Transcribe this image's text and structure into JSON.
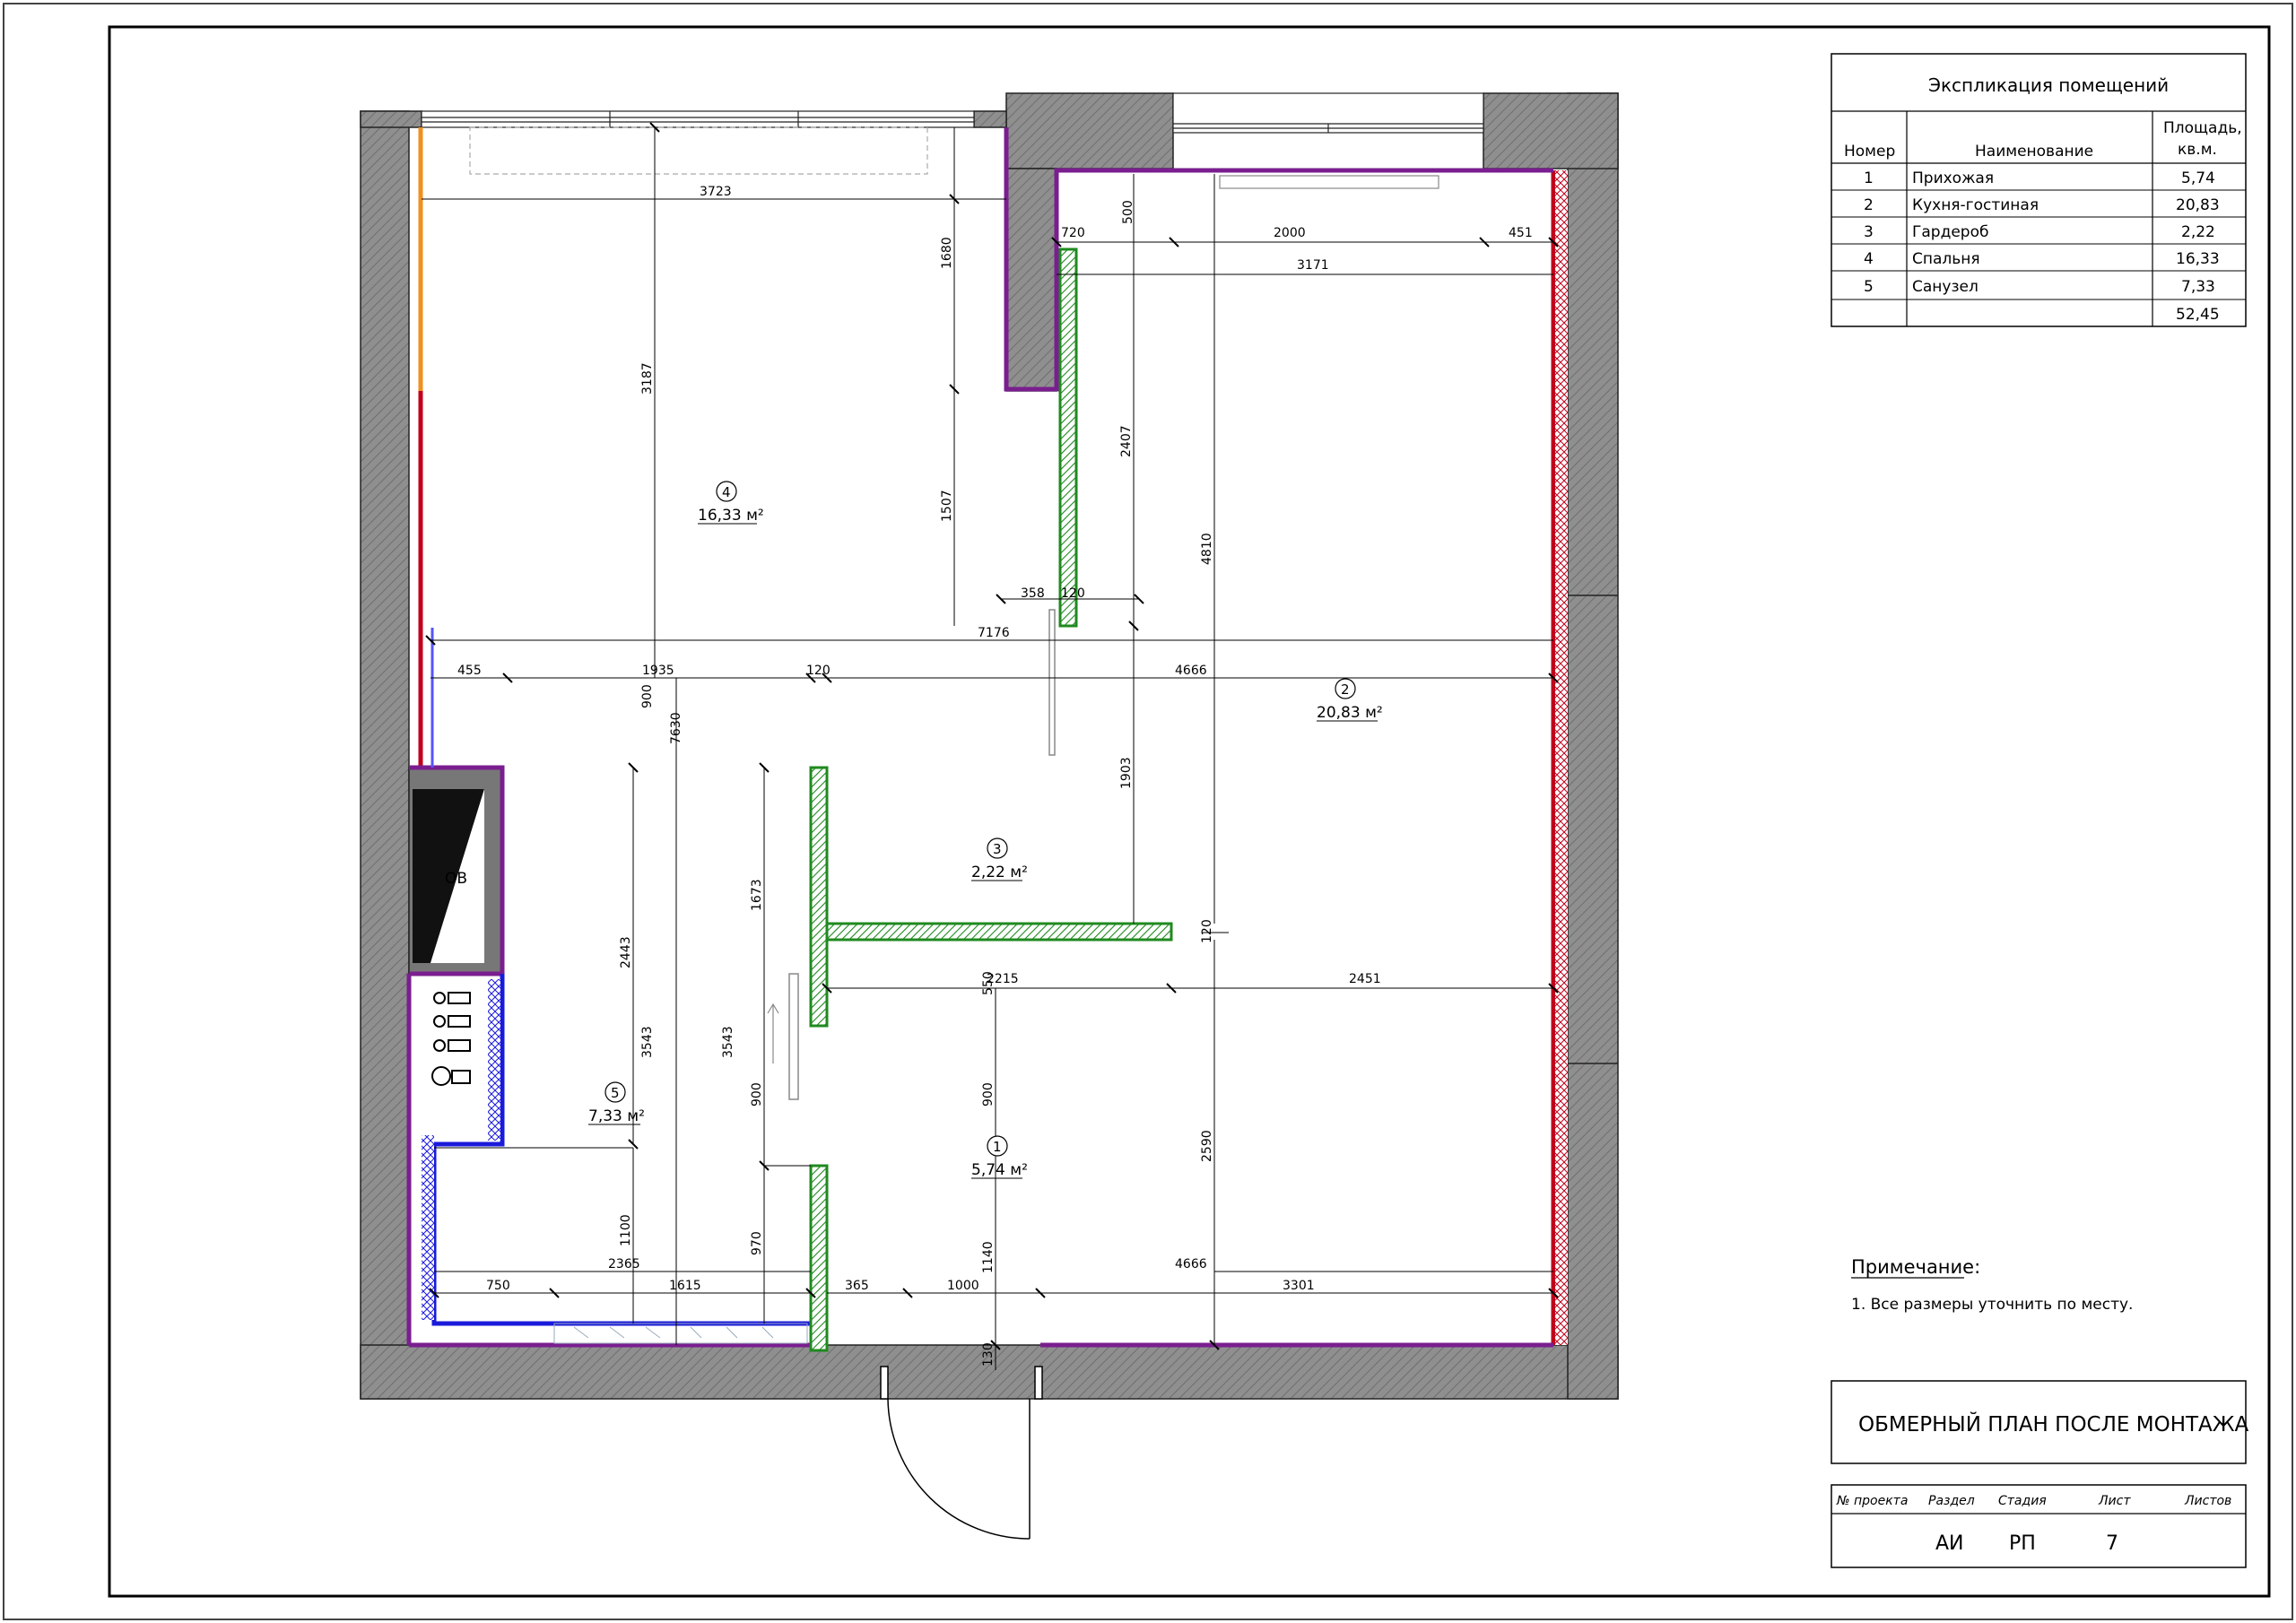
{
  "explication": {
    "title": "Экспликация помещений",
    "headers": {
      "number": "Номер",
      "name": "Наименование",
      "area_l1": "Площадь,",
      "area_l2": "кв.м."
    },
    "rows": [
      {
        "num": "1",
        "name": "Прихожая",
        "area": "5,74"
      },
      {
        "num": "2",
        "name": "Кухня-гостиная",
        "area": "20,83"
      },
      {
        "num": "3",
        "name": "Гардероб",
        "area": "2,22"
      },
      {
        "num": "4",
        "name": "Спальня",
        "area": "16,33"
      },
      {
        "num": "5",
        "name": "Санузел",
        "area": "7,33"
      }
    ],
    "total": "52,45"
  },
  "rooms": [
    {
      "num": "1",
      "area": "5,74 м²"
    },
    {
      "num": "2",
      "area": "20,83 м²"
    },
    {
      "num": "3",
      "area": "2,22 м²"
    },
    {
      "num": "4",
      "area": "16,33 м²"
    },
    {
      "num": "5",
      "area": "7,33 м²"
    }
  ],
  "equipment_label": "ОВ",
  "dimensions": {
    "d3723": "3723",
    "d500": "500",
    "d720": "720",
    "d2000": "2000",
    "d451": "451",
    "d3171": "3171",
    "d1680": "1680",
    "d3187": "3187",
    "d2407": "2407",
    "d1507": "1507",
    "d4810": "4810",
    "d358": "358",
    "d120a": "120",
    "d7176": "7176",
    "d455": "455",
    "d1935": "1935",
    "d120b": "120",
    "d4666a": "4666",
    "d900a": "900",
    "d7630": "7630",
    "d1903": "1903",
    "d2443": "2443",
    "d1673": "1673",
    "d120c": "120",
    "d550": "550",
    "d2215": "2215",
    "d2451": "2451",
    "d3543a": "3543",
    "d3543b": "3543",
    "d900b": "900",
    "d900c": "900",
    "d2590": "2590",
    "d1100": "1100",
    "d970": "970",
    "d1140": "1140",
    "d750": "750",
    "d2365": "2365",
    "d1615": "1615",
    "d365": "365",
    "d1000": "1000",
    "d4666b": "4666",
    "d3301": "3301",
    "d130": "130"
  },
  "note": {
    "title": "Примечание:",
    "text": "1. Все размеры уточнить по месту."
  },
  "stamp": {
    "title": "ОБМЕРНЫЙ ПЛАН ПОСЛЕ МОНТАЖА",
    "labels": {
      "project": "№ проекта",
      "section": "Раздел",
      "stage": "Стадия",
      "sheet": "Лист",
      "sheets": "Листов"
    },
    "values": {
      "section": "АИ",
      "stage": "РП",
      "sheet": "7"
    }
  },
  "colors": {
    "wall": "#8c8c8c",
    "purple": "#7a1e8f",
    "green": "#1f8a1f",
    "blue": "#1a1adb",
    "red": "#c0001c",
    "orange": "#f09020",
    "dim": "#000000"
  }
}
